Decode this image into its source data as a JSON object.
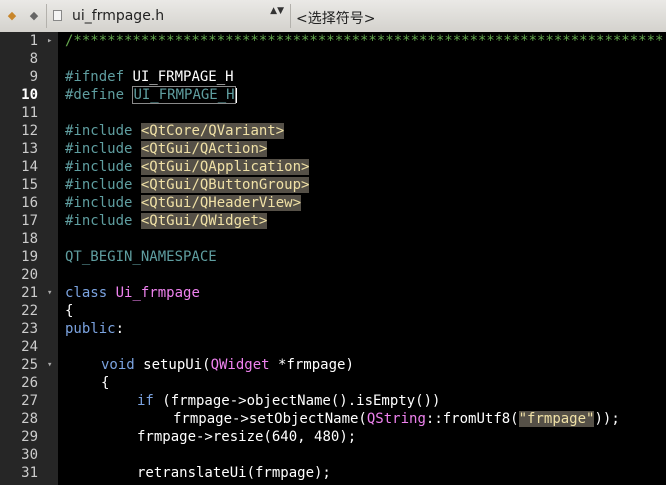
{
  "toolbar": {
    "back_icon": "◆",
    "forward_icon": "◆",
    "file_name": "ui_frmpage.h",
    "file_arrows": "▲▼",
    "symbol_placeholder": "<选择符号>"
  },
  "editor": {
    "line_numbers": [
      "1",
      "8",
      "9",
      "10",
      "11",
      "12",
      "13",
      "14",
      "15",
      "16",
      "17",
      "18",
      "19",
      "20",
      "21",
      "22",
      "23",
      "24",
      "25",
      "26",
      "27",
      "28",
      "29",
      "30",
      "31"
    ],
    "lines": {
      "l1": "/**********************************************************************",
      "l9_kw": "#ifndef",
      "l9_rest": " UI_FRMPAGE_H",
      "l10_kw": "#define",
      "l10_name": "UI_FRMPAGE_H",
      "inc": "#include",
      "inc1": "<QtCore/QVariant>",
      "inc2": "<QtGui/QAction>",
      "inc3": "<QtGui/QApplication>",
      "inc4": "<QtGui/QButtonGroup>",
      "inc5": "<QtGui/QHeaderView>",
      "inc6": "<QtGui/QWidget>",
      "l19": "QT_BEGIN_NAMESPACE",
      "l21_kw": "class",
      "l21_name": "Ui_frmpage",
      "l22": "{",
      "l23_kw": "public",
      "l23_colon": ":",
      "l25_kw": "void",
      "l25_fn": " setupUi(",
      "l25_type": "QWidget",
      "l25_rest": " *frmpage)",
      "l26": "{",
      "l27_kw": "if",
      "l27_rest": " (frmpage->objectName().isEmpty())",
      "l28_a": "frmpage->setObjectName(",
      "l28_type": "QString",
      "l28_b": "::fromUtf8(",
      "l28_str": "\"frmpage\"",
      "l28_c": "));",
      "l29_a": "frmpage->resize(",
      "l29_n1": "640",
      "l29_sep": ", ",
      "l29_n2": "480",
      "l29_c": ");",
      "l31": "retranslateUi(frmpage);"
    }
  }
}
